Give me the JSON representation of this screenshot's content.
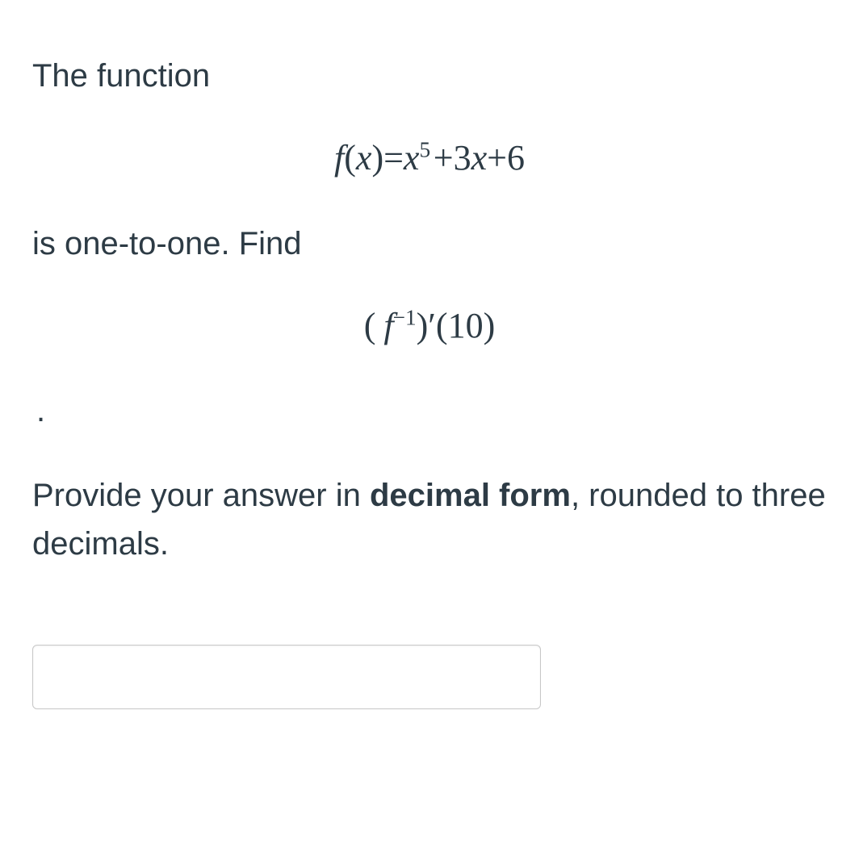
{
  "question": {
    "intro": "The function",
    "formula1_html": "<span class='math-i'>f</span>(<span class='math-i'>x</span>)=<span class='math-i'>x</span><sup>5</sup>&#8202;+3<span class='math-i'>x</span>+6",
    "mid": "is one-to-one. Find",
    "formula2_html": "(<span class='math-i tight'>&nbsp;f</span><sup>&minus;1</sup>)&prime;(10)",
    "dot": ".",
    "instruction_pre": "Provide your answer in ",
    "instruction_bold": "decimal form",
    "instruction_post": ", rounded to three decimals."
  },
  "answer": {
    "value": "",
    "placeholder": ""
  }
}
